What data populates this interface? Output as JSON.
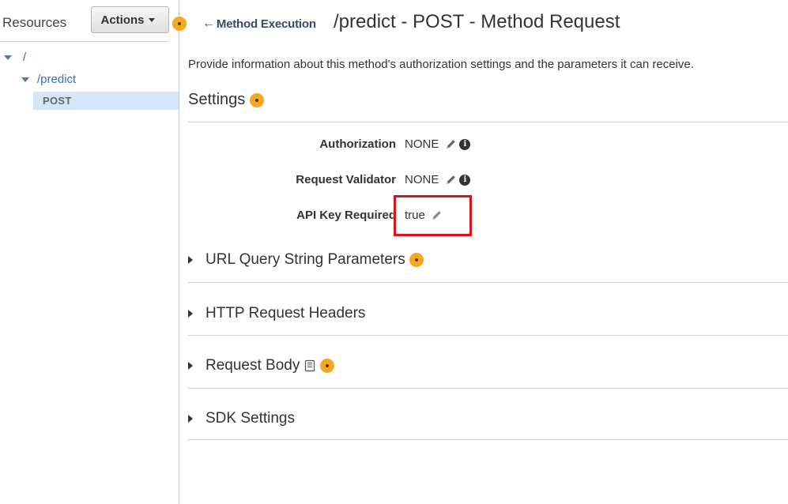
{
  "sidebar": {
    "title": "Resources",
    "actions_label": "Actions",
    "tree": {
      "root": "/",
      "predict": "/predict",
      "method": "POST"
    }
  },
  "header": {
    "back_label": "Method Execution",
    "title": "/predict - POST - Method Request"
  },
  "description": "Provide information about this method's authorization settings and the parameters it can receive.",
  "settings": {
    "heading": "Settings",
    "authorization": {
      "label": "Authorization",
      "value": "NONE"
    },
    "request_validator": {
      "label": "Request Validator",
      "value": "NONE"
    },
    "api_key_required": {
      "label": "API Key Required",
      "value": "true"
    }
  },
  "sections": {
    "url_query": "URL Query String Parameters",
    "http_headers": "HTTP Request Headers",
    "request_body": "Request Body",
    "sdk_settings": "SDK Settings"
  },
  "colors": {
    "help_badge": "#f5a623",
    "highlight_border": "#d4161c",
    "link": "#3b6fb6",
    "selected_row": "#d5e7f7"
  },
  "icons": {
    "help": "help-dot-icon",
    "edit": "pencil-icon",
    "info": "info-icon",
    "model": "book-icon",
    "back": "arrow-left-icon"
  }
}
